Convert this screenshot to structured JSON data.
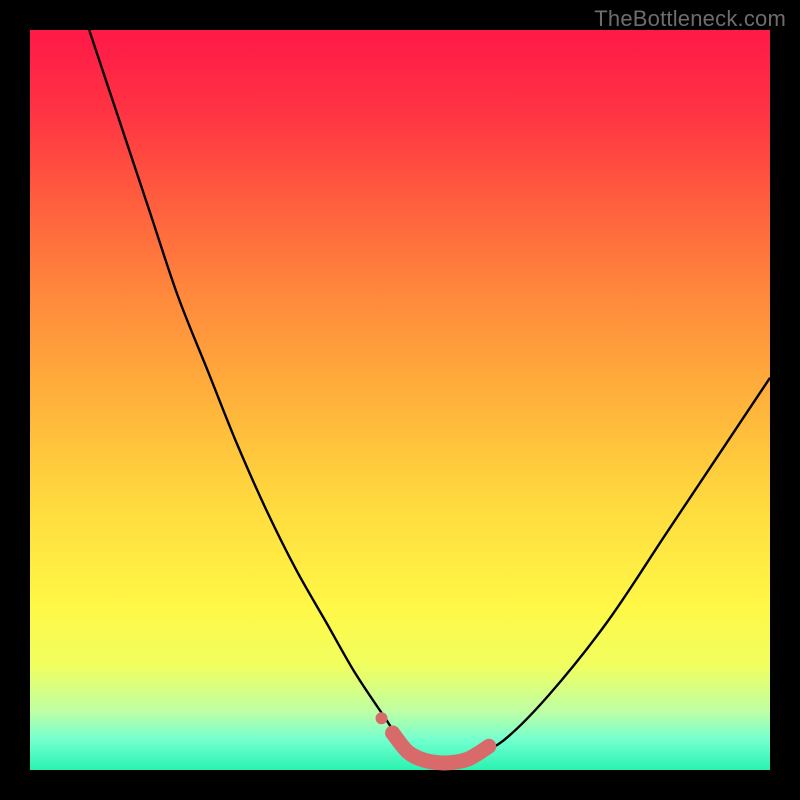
{
  "watermark": "TheBottleneck.com",
  "palette": {
    "background": "#000000",
    "curve_stroke": "#000000",
    "marker_fill": "#d96a6a",
    "marker_stroke": "#d96a6a"
  },
  "chart_data": {
    "type": "line",
    "title": "",
    "xlabel": "",
    "ylabel": "",
    "xlim": [
      0,
      100
    ],
    "ylim": [
      0,
      100
    ],
    "grid": false,
    "legend": false,
    "series": [
      {
        "name": "bottleneck-curve",
        "x": [
          8,
          12,
          16,
          20,
          24,
          28,
          32,
          36,
          40,
          44,
          48,
          50,
          52,
          55,
          58,
          60,
          64,
          70,
          78,
          86,
          94,
          100
        ],
        "y": [
          100,
          88,
          76,
          64,
          54,
          44,
          35,
          27,
          20,
          13,
          7,
          4,
          2,
          1,
          1,
          2,
          4,
          10,
          20,
          32,
          44,
          53
        ]
      }
    ],
    "markers": {
      "name": "highlight-segment",
      "points": [
        {
          "x": 49,
          "y": 5
        },
        {
          "x": 51,
          "y": 2.5
        },
        {
          "x": 53,
          "y": 1.4
        },
        {
          "x": 55,
          "y": 1
        },
        {
          "x": 57,
          "y": 1
        },
        {
          "x": 59,
          "y": 1.4
        },
        {
          "x": 60.5,
          "y": 2.2
        },
        {
          "x": 62,
          "y": 3.2
        }
      ],
      "isolated_dot": {
        "x": 47.5,
        "y": 7
      }
    }
  }
}
